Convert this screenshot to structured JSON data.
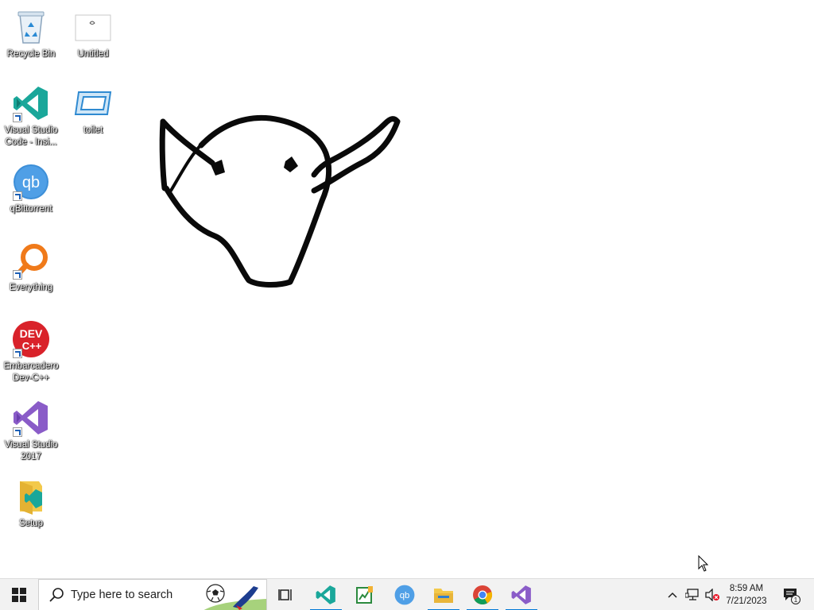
{
  "desktop": {
    "icons": [
      {
        "label": "Recycle Bin"
      },
      {
        "label": "Untitled"
      },
      {
        "label": "Visual Studio Code - Insi..."
      },
      {
        "label": "toilet"
      },
      {
        "label": "qBittorrent"
      },
      {
        "label": "Everything"
      },
      {
        "label": "Embarcadero Dev-C++"
      },
      {
        "label": "Visual Studio 2017"
      },
      {
        "label": "Setup"
      }
    ],
    "icon_badges": {
      "qbittorrent": "qb",
      "devcpp_top": "DEV",
      "devcpp_bottom": "C++"
    }
  },
  "taskbar": {
    "search_placeholder": "Type here to search",
    "pinned_apps": [
      {
        "name": "Task View",
        "icon": "task-view-icon",
        "active": false
      },
      {
        "name": "Visual Studio Code - Insiders",
        "icon": "vscode-insiders-icon",
        "active": true
      },
      {
        "name": "Notepad++ / editor",
        "icon": "chart-editor-icon",
        "active": false
      },
      {
        "name": "qBittorrent",
        "icon": "qbittorrent-icon",
        "active": false,
        "badge": "qb"
      },
      {
        "name": "File Explorer",
        "icon": "folder-icon",
        "active": true
      },
      {
        "name": "Google Chrome",
        "icon": "chrome-icon",
        "active": true
      },
      {
        "name": "Visual Studio 2017",
        "icon": "visual-studio-icon",
        "active": true
      }
    ],
    "clock": {
      "time": "8:59 AM",
      "date": "7/21/2023"
    },
    "notification_count": "1"
  },
  "colors": {
    "accent": "#0078d7",
    "taskbar_bg": "#f2f2f2",
    "desktop_bg": "#ffffff"
  }
}
